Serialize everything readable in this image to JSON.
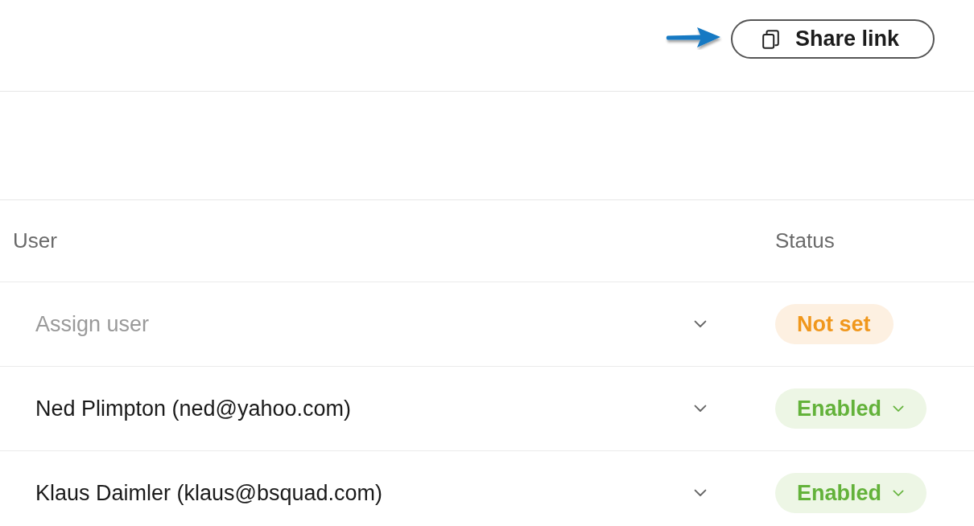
{
  "header": {
    "share_button": {
      "label": "Share link"
    }
  },
  "table": {
    "columns": [
      "User",
      "Status"
    ],
    "rows": [
      {
        "user": {
          "placeholder": "Assign user"
        },
        "status": {
          "label": "Not set",
          "kind": "not_set"
        }
      },
      {
        "user": {
          "value": "Ned Plimpton (ned@yahoo.com)"
        },
        "status": {
          "label": "Enabled",
          "kind": "enabled"
        }
      },
      {
        "user": {
          "value": "Klaus Daimler (klaus@bsquad.com)"
        },
        "status": {
          "label": "Enabled",
          "kind": "enabled"
        }
      }
    ]
  }
}
